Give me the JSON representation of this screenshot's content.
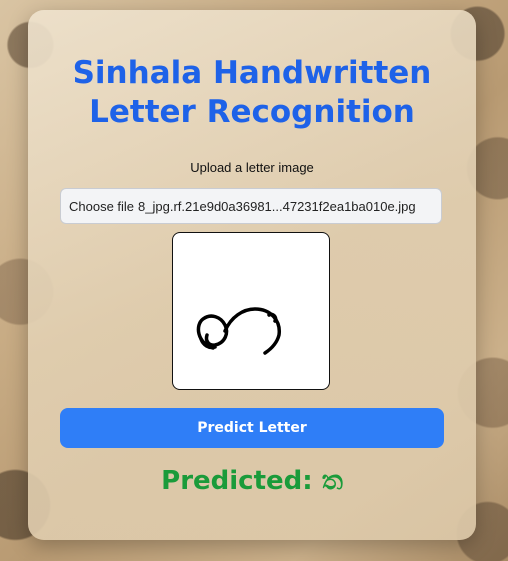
{
  "app": {
    "title": "Sinhala Handwritten Letter Recognition"
  },
  "upload": {
    "label": "Upload a letter image",
    "button_text": "Choose file",
    "file_name": "8_jpg.rf.21e9d0a36981...47231f2ea1ba010e.jpg"
  },
  "preview": {
    "icon": "handwritten-letter-image"
  },
  "actions": {
    "predict_label": "Predict Letter"
  },
  "result": {
    "prefix": "Predicted:",
    "letter": "ත"
  },
  "colors": {
    "title": "#1e62e8",
    "button": "#2f7ef7",
    "result": "#1a9b3a"
  }
}
